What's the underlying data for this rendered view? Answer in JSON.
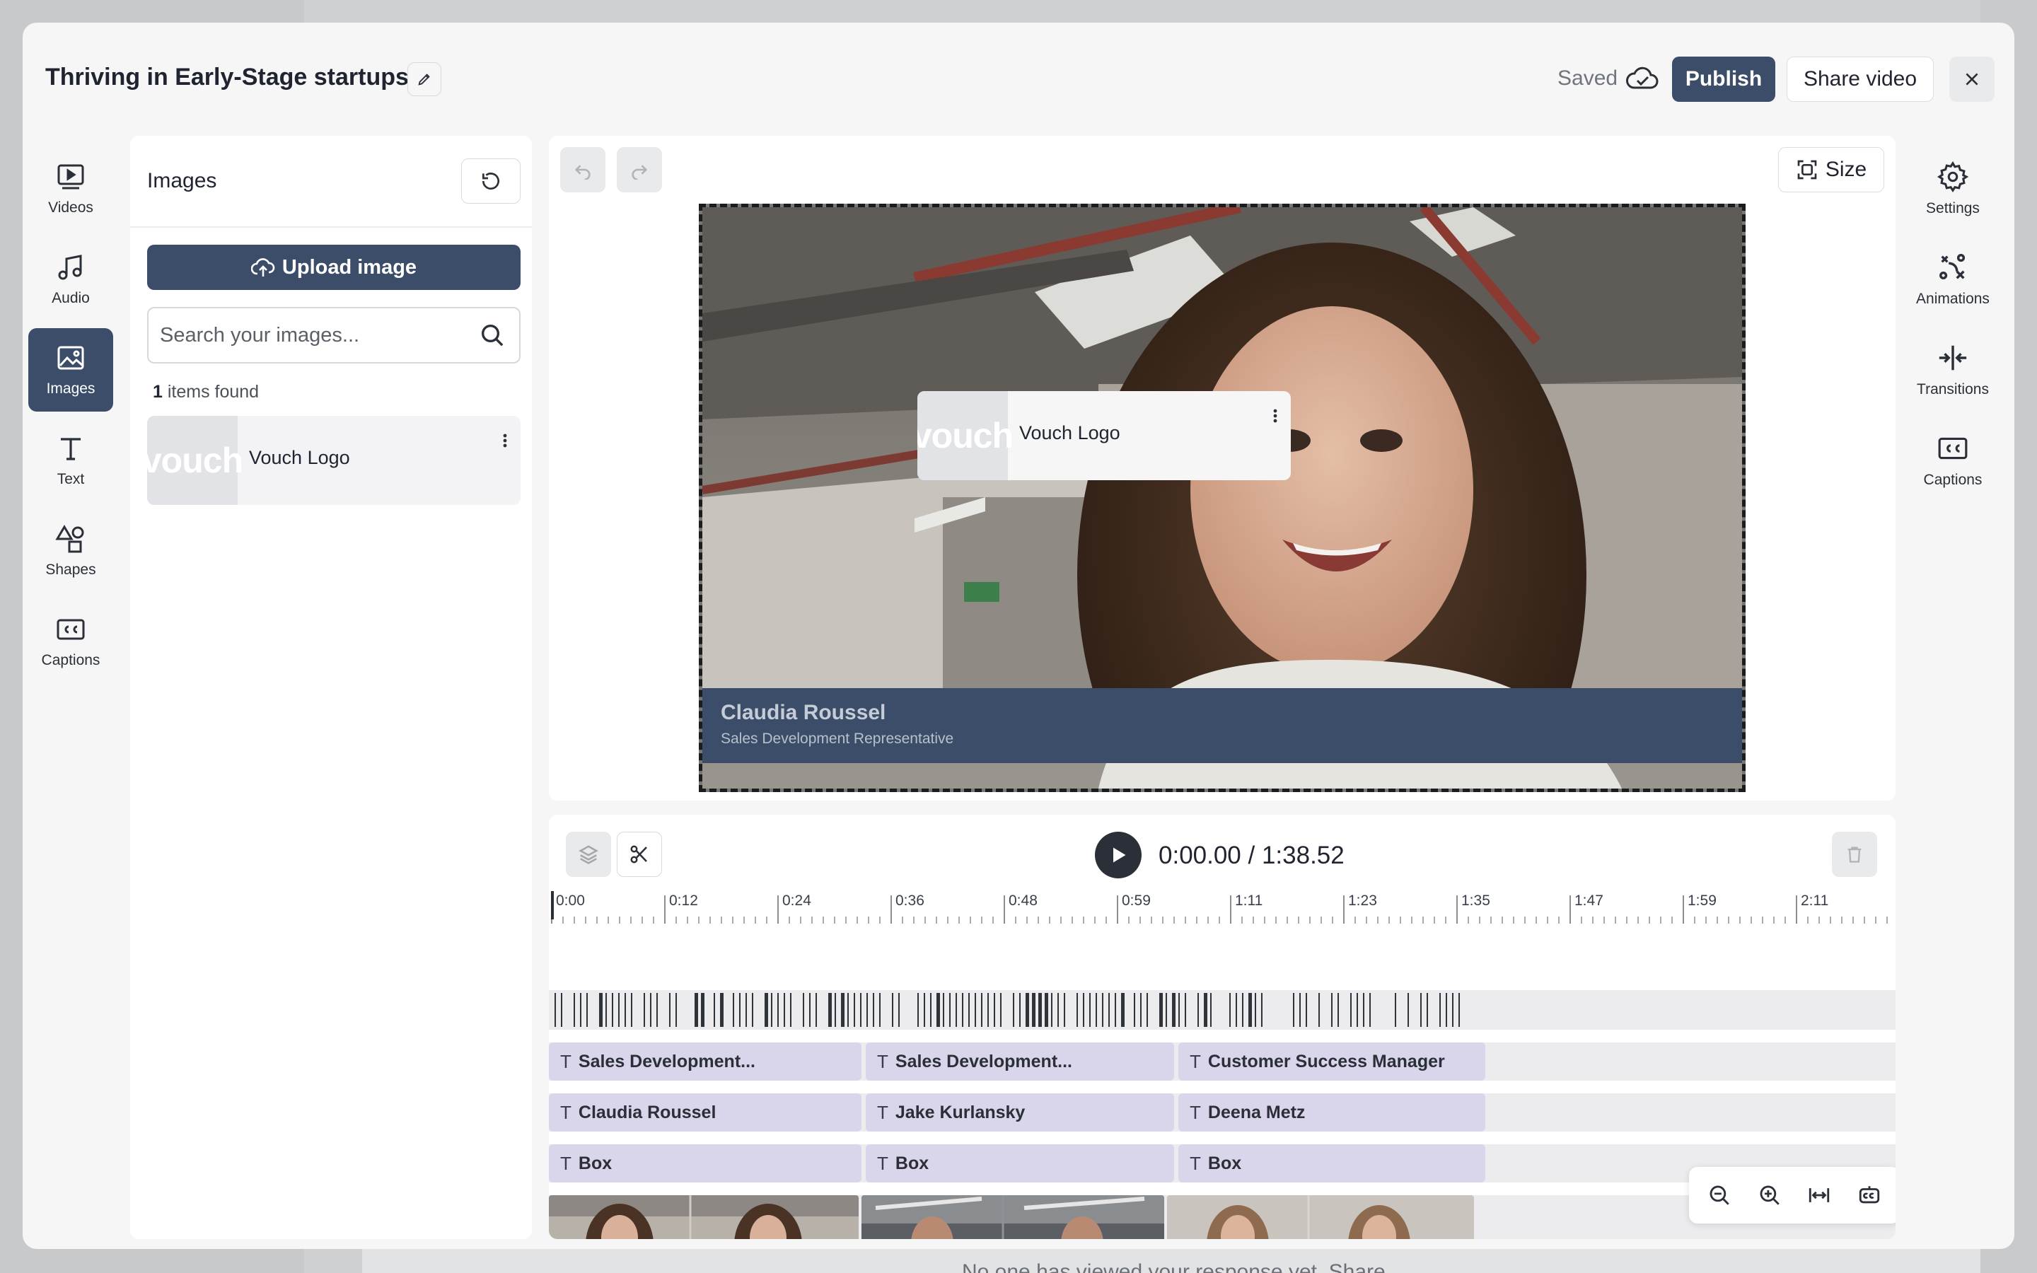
{
  "background": {
    "footer_text": "No one has viewed your response yet. Share"
  },
  "header": {
    "title": "Thriving in Early-Stage startups",
    "saved_label": "Saved",
    "publish_label": "Publish",
    "share_label": "Share video"
  },
  "left_nav": {
    "active": "Images",
    "items": [
      {
        "label": "Videos",
        "icon": "video-icon"
      },
      {
        "label": "Audio",
        "icon": "music-note-icon"
      },
      {
        "label": "Images",
        "icon": "image-icon"
      },
      {
        "label": "Text",
        "icon": "text-icon"
      },
      {
        "label": "Shapes",
        "icon": "shapes-icon"
      },
      {
        "label": "Captions",
        "icon": "captions-icon"
      }
    ]
  },
  "images_panel": {
    "title": "Images",
    "upload_label": "Upload image",
    "search_placeholder": "Search your images...",
    "count": "1",
    "count_suffix": " items found",
    "items": [
      {
        "label": "Vouch Logo",
        "thumb_text": "vouch"
      }
    ]
  },
  "preview": {
    "size_label": "Size",
    "lower_third": {
      "name": "Claudia Roussel",
      "role": "Sales Development Representative"
    },
    "overlay": {
      "label": "Vouch Logo",
      "thumb_text": "vouch"
    }
  },
  "right_nav": {
    "items": [
      {
        "label": "Settings",
        "icon": "gear-icon"
      },
      {
        "label": "Animations",
        "icon": "animations-icon"
      },
      {
        "label": "Transitions",
        "icon": "transitions-icon"
      },
      {
        "label": "Captions",
        "icon": "captions-icon"
      }
    ]
  },
  "timeline": {
    "time_display": "0:00.00 / 1:38.52",
    "ruler_labels": [
      "0:00",
      "0:12",
      "0:24",
      "0:36",
      "0:48",
      "0:59",
      "1:11",
      "1:23",
      "1:35",
      "1:47",
      "1:59",
      "2:11"
    ],
    "text_tracks": [
      [
        "Sales Development...",
        "Sales Development...",
        "Customer Success Manager"
      ],
      [
        "Claudia Roussel",
        "Jake Kurlansky",
        "Deena Metz"
      ],
      [
        "Box",
        "Box",
        "Box"
      ]
    ]
  }
}
